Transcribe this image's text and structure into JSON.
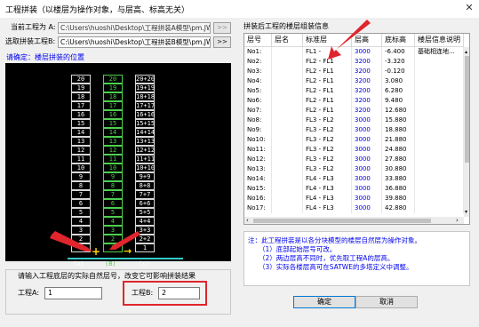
{
  "window": {
    "title": "工程拼装（以楼层为操作对象，与层高、标高无关）",
    "close_glyph": "✕"
  },
  "left": {
    "current_project_label": "当前工程为 A:",
    "current_project_path": "C:\\Users\\huoshi\\Desktop\\工程拼装A模型\\pm.JWS",
    "select_project_label": "选取拼装工程B:",
    "select_project_path": "C:\\Users\\huoshi\\Desktop\\工程拼装B模型\\pm.JWS",
    "browse_label": ">>",
    "confirm_position_label": "请确定：楼层拼装的位置",
    "col_a_floors": [
      "20",
      "19",
      "18",
      "17",
      "16",
      "15",
      "14",
      "13",
      "12",
      "11",
      "10",
      "9",
      "8",
      "7",
      "6",
      "5",
      "4",
      "3",
      "2",
      "1"
    ],
    "col_b_floors": [
      "20",
      "19",
      "18",
      "17",
      "16",
      "15",
      "14",
      "13",
      "12",
      "11",
      "10",
      "9",
      "8",
      "7",
      "6",
      "5",
      "4",
      "3",
      "2",
      "1"
    ],
    "col_c_floors": [
      "20+20",
      "19+19",
      "18+18",
      "17+17",
      "16+16",
      "15+15",
      "14+14",
      "13+13",
      "12+12",
      "11+11",
      "10+10",
      "9+9",
      "8+8",
      "7+7",
      "6+6",
      "5+5",
      "4+4",
      "3+3",
      "2+2",
      "1"
    ],
    "axis_labels": [
      "(A)",
      "(B)",
      "(C)"
    ],
    "plus_glyph": "+",
    "arrow_glyph": "→",
    "group_title": "请输入工程底层的实际自然层号，改变它可影响拼装结果",
    "project_a_label": "工程A:",
    "project_a_value": "1",
    "project_b_label": "工程B:",
    "project_b_value": "2"
  },
  "right": {
    "title": "拼装后工程的楼层组装信息",
    "columns": [
      "层号",
      "层名",
      "标准层",
      "层高",
      "底标高",
      "楼层信息说明"
    ],
    "rows": [
      [
        "No1:",
        "",
        "FL1 -",
        "3000",
        "-6.400",
        "基础相连地..."
      ],
      [
        "No2:",
        "",
        "FL2 - FL1",
        "3200",
        "-3.320",
        ""
      ],
      [
        "No3:",
        "",
        "FL2 - FL1",
        "3200",
        "-0.120",
        ""
      ],
      [
        "No4:",
        "",
        "FL2 - FL1",
        "3200",
        "3.080",
        ""
      ],
      [
        "No5:",
        "",
        "FL2 - FL1",
        "3200",
        "6.280",
        ""
      ],
      [
        "No6:",
        "",
        "FL2 - FL1",
        "3200",
        "9.480",
        ""
      ],
      [
        "No7:",
        "",
        "FL2 - FL1",
        "3200",
        "12.680",
        ""
      ],
      [
        "No8:",
        "",
        "FL3 - FL2",
        "3000",
        "15.880",
        ""
      ],
      [
        "No9:",
        "",
        "FL3 - FL2",
        "3000",
        "18.880",
        ""
      ],
      [
        "No10:",
        "",
        "FL3 - FL2",
        "3000",
        "21.880",
        ""
      ],
      [
        "No11:",
        "",
        "FL3 - FL2",
        "3000",
        "24.880",
        ""
      ],
      [
        "No12:",
        "",
        "FL3 - FL2",
        "3000",
        "27.880",
        ""
      ],
      [
        "No13:",
        "",
        "FL3 - FL2",
        "3000",
        "30.880",
        ""
      ],
      [
        "No14:",
        "",
        "FL4 - FL3",
        "3000",
        "33.880",
        ""
      ],
      [
        "No15:",
        "",
        "FL4 - FL3",
        "3000",
        "36.880",
        ""
      ],
      [
        "No16:",
        "",
        "FL4 - FL3",
        "3000",
        "39.880",
        ""
      ],
      [
        "No17:",
        "",
        "FL4 - FL3",
        "3000",
        "42.880",
        ""
      ]
    ],
    "notes": [
      "注：此工程拼装是以各分块模型的楼层自然层为操作对象。",
      "（1）底部起始层号可改。",
      "（2）两边层高不同时，优先取工程A的层高。",
      "（3）实际各楼层高可在SATWE的多塔定义中调整。"
    ],
    "ok_label": "确定",
    "cancel_label": "取消"
  },
  "colors": {
    "accent_blue": "#0000ee",
    "highlight_red": "#e0252c",
    "grid_green": "#4fcf4f",
    "canvas_bg": "#000000"
  }
}
